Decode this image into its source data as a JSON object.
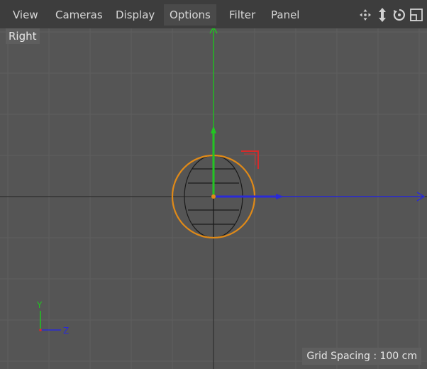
{
  "menu": {
    "items": [
      {
        "label": "View"
      },
      {
        "label": "Cameras"
      },
      {
        "label": "Display"
      },
      {
        "label": "Options"
      },
      {
        "label": "Filter"
      },
      {
        "label": "Panel"
      }
    ],
    "active_item": "Options"
  },
  "toolbar": {
    "icons": [
      "move-icon",
      "zoom-icon",
      "rotate-icon",
      "maximize-icon"
    ]
  },
  "viewport": {
    "view_name": "Right",
    "grid_spacing": "Grid Spacing : 100 cm",
    "axis_indicator": {
      "y": "Y",
      "z": "Z"
    }
  },
  "colors": {
    "background": "#555555",
    "grid": "#5e5e5e",
    "axis_y": "#22c522",
    "axis_z": "#2a2ad6",
    "axis_x": "#d62a2a",
    "selection": "#e08a18"
  }
}
